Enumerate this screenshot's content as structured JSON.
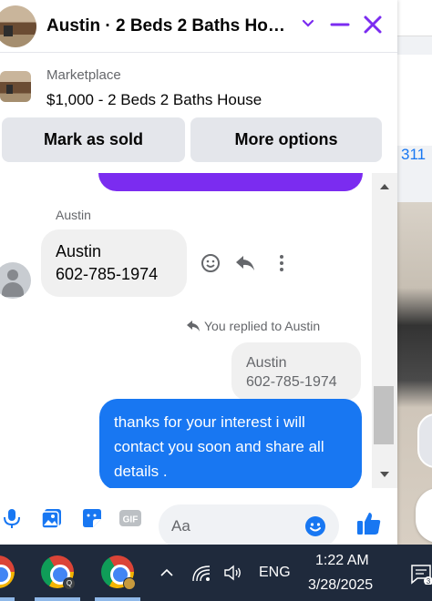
{
  "header": {
    "title": "Austin · 2 Beds 2 Baths Ho…"
  },
  "listing": {
    "source": "Marketplace",
    "title": "$1,000 - 2 Beds 2 Baths House"
  },
  "actions": {
    "mark_sold": "Mark as sold",
    "more_options": "More options"
  },
  "background": {
    "partial_number": "311"
  },
  "messages": {
    "sender": "Austin",
    "incoming_line1": "Austin",
    "incoming_line2": "602-785-1974",
    "replied_note": "You replied to Austin",
    "quoted_line1": "Austin",
    "quoted_line2": "602-785-1974",
    "outgoing": "thanks for your interest i will contact you soon and share all details ."
  },
  "composer": {
    "placeholder": "Aa",
    "gif_label": "GIF"
  },
  "taskbar": {
    "lang": "ENG",
    "time": "1:22 AM",
    "date": "3/28/2025",
    "badge_q": "Q",
    "notif_count": "3"
  },
  "colors": {
    "accent": "#7b2cf0",
    "messenger_blue": "#1877f2",
    "bubble_gray": "#f0f0f0"
  }
}
